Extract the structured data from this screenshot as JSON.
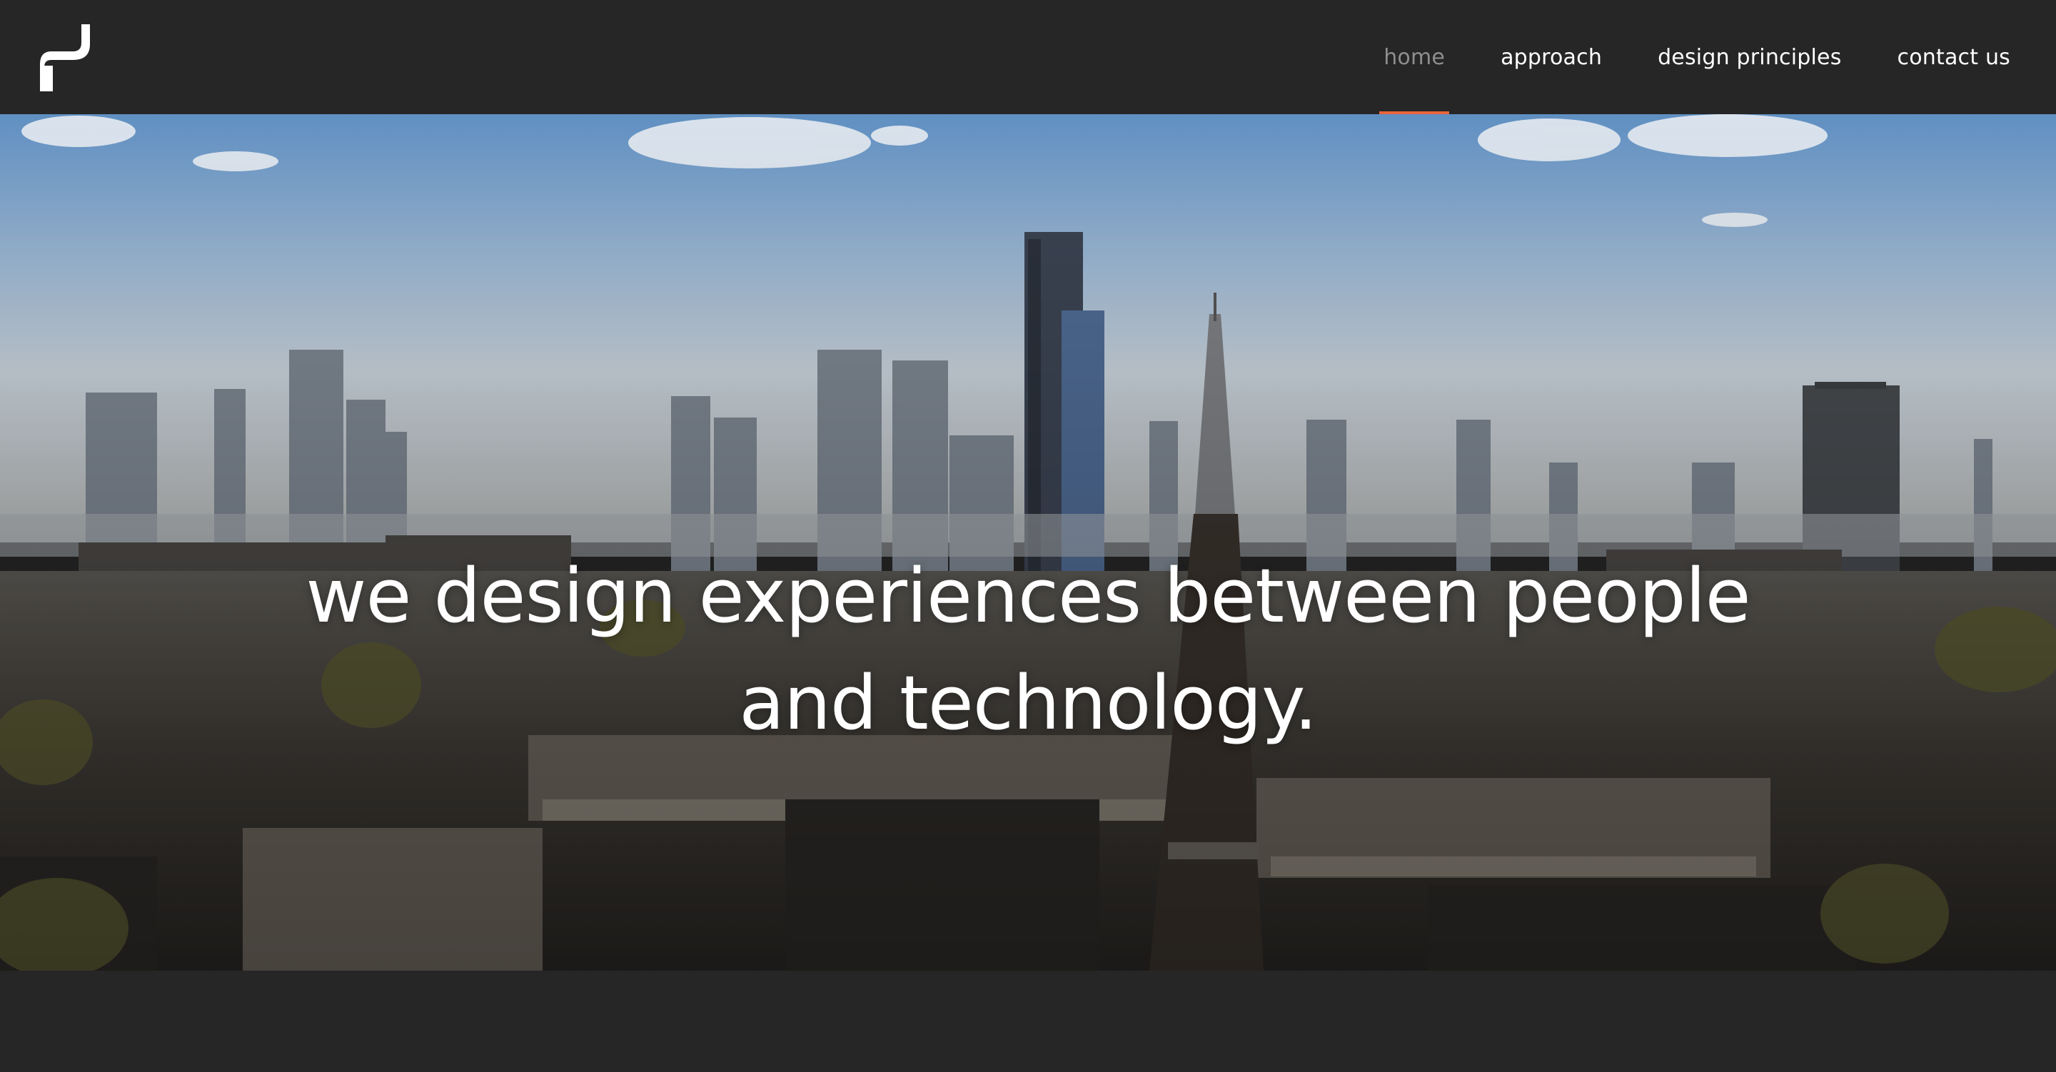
{
  "nav": {
    "items": [
      {
        "label": "home",
        "active": true
      },
      {
        "label": "approach",
        "active": false
      },
      {
        "label": "design principles",
        "active": false
      },
      {
        "label": "contact us",
        "active": false
      }
    ]
  },
  "hero": {
    "headline_line1": "we design experiences between people",
    "headline_line2": "and technology.",
    "image": "city-skyline-photo"
  },
  "colors": {
    "header_bg": "#262626",
    "active_underline": "#e8643c",
    "active_text": "#8e8e8e",
    "text": "#ffffff"
  }
}
